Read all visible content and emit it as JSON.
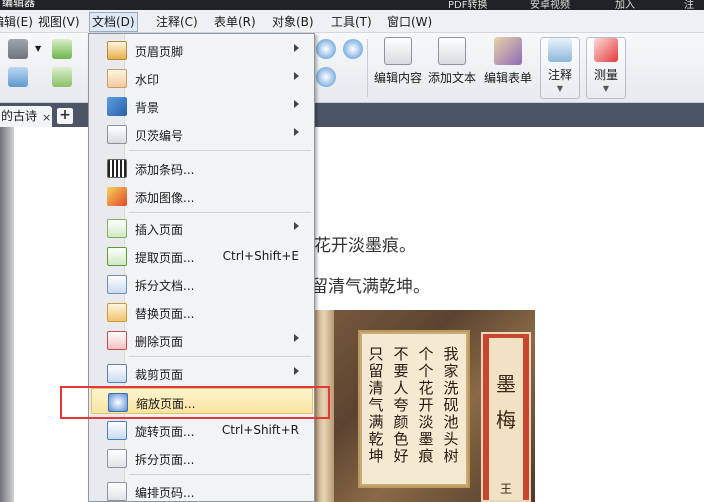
{
  "window": {
    "title": "编辑器",
    "top_right": [
      "PDF转换",
      "安卓视频",
      "加入",
      "注"
    ]
  },
  "menubar": [
    {
      "label": "编辑(E)"
    },
    {
      "label": "视图(V)"
    },
    {
      "label": "文档(D)"
    },
    {
      "label": "注释(C)"
    },
    {
      "label": "表单(R)"
    },
    {
      "label": "对象(B)"
    },
    {
      "label": "工具(T)"
    },
    {
      "label": "窗口(W)"
    }
  ],
  "toolbar": {
    "edit_content": "编辑内容",
    "add_text": "添加文本",
    "edit_form": "编辑表单",
    "annotate": "注释",
    "measure": "测量"
  },
  "tab": {
    "label": "的古诗",
    "close": "×",
    "add": "+"
  },
  "document": {
    "line1": "花开淡墨痕。",
    "line2": "留清气满乾坤。",
    "painting": {
      "cols": [
        "我家洗砚池头树",
        "个个花开淡墨痕",
        "不要人夸颜色好",
        "只留清气满乾坤"
      ],
      "title": "墨梅",
      "author": "王"
    }
  },
  "dropdown": {
    "items": [
      {
        "label": "页眉页脚",
        "submenu": true
      },
      {
        "label": "水印",
        "submenu": true
      },
      {
        "label": "背景",
        "submenu": true
      },
      {
        "label": "贝茨编号",
        "submenu": true
      },
      {
        "label": "添加条码..."
      },
      {
        "label": "添加图像..."
      },
      {
        "label": "插入页面",
        "submenu": true
      },
      {
        "label": "提取页面...",
        "shortcut": "Ctrl+Shift+E"
      },
      {
        "label": "拆分文档..."
      },
      {
        "label": "替换页面..."
      },
      {
        "label": "删除页面",
        "submenu": true
      },
      {
        "label": "裁剪页面",
        "submenu": true
      },
      {
        "label": "缩放页面..."
      },
      {
        "label": "旋转页面...",
        "shortcut": "Ctrl+Shift+R"
      },
      {
        "label": "拆分页面..."
      },
      {
        "label": "编排页码..."
      }
    ]
  }
}
